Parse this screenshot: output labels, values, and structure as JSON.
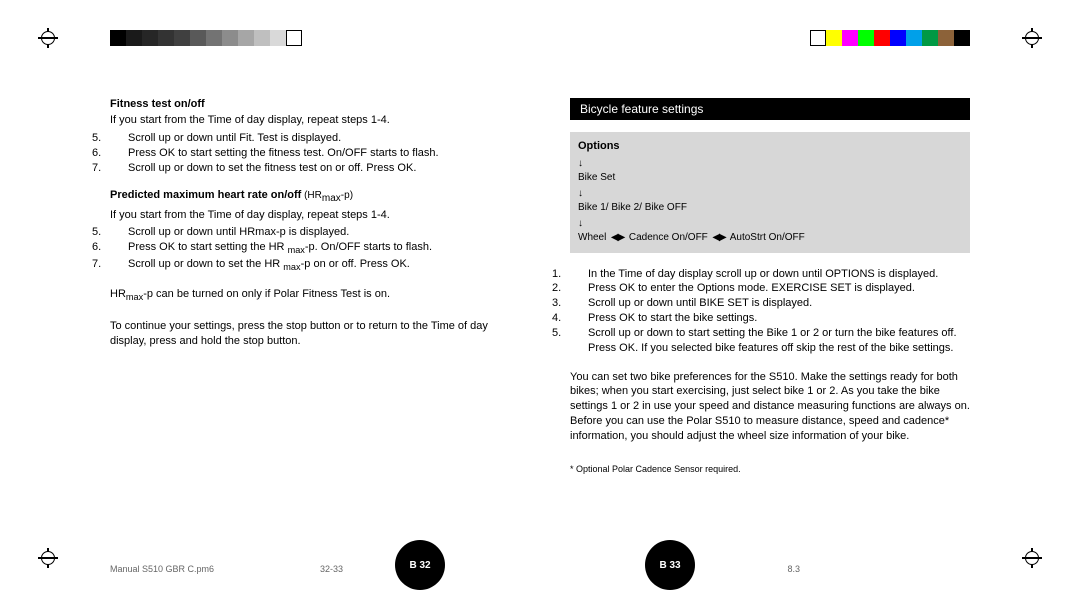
{
  "colorbar_left": [
    "#000000",
    "#1a1a1a",
    "#262626",
    "#333333",
    "#404040",
    "#595959",
    "#737373",
    "#8c8c8c",
    "#a6a6a6",
    "#bfbfbf",
    "#d9d9d9",
    "#ffffff"
  ],
  "colorbar_right": [
    "#ffffff",
    "#ffff00",
    "#ff00ff",
    "#00ff00",
    "#ff0000",
    "#0000ff",
    "#00a0e9",
    "#009944",
    "#8c6239",
    "#000000"
  ],
  "left": {
    "h1": "Fitness test on/off",
    "p1": "If you start from the Time of day display, repeat steps 1-4.",
    "s5": "Scroll up or down until Fit. Test is displayed.",
    "s6": "Press OK to start setting the fitness test. On/OFF starts to flash.",
    "s7": "Scroll up or down to set the fitness test on or off. Press OK.",
    "h2a": "Predicted maximum heart rate on/off",
    "h2b": " (HR",
    "h2c": "max",
    "h2d": "-p)",
    "p2": "If you start from the Time of day display, repeat steps 1-4.",
    "s5b": "Scroll up or down until HRmax-p is displayed.",
    "s6b_a": "Press OK to start setting the HR ",
    "s6b_b": "max",
    "s6b_c": "-p. On/OFF starts to flash.",
    "s7b_a": "Scroll up or down to set the HR ",
    "s7b_b": "max",
    "s7b_c": "-p on or off. Press OK.",
    "note_a": "HR",
    "note_b": "max",
    "note_c": "-p can be turned on only if Polar Fitness Test is on.",
    "tail": "To continue your settings, press the stop button or to return to the Time of day display, press and hold the stop button."
  },
  "right": {
    "band": "Bicycle feature settings",
    "opt_title": "Options",
    "opt_l2": "Bike Set",
    "opt_l3": "Bike 1/ Bike 2/ Bike OFF",
    "opt_l4a": "Wheel",
    "opt_l4b": "Cadence On/OFF",
    "opt_l4c": "AutoStrt On/OFF",
    "s1": "In the Time of day display scroll up or down until OPTIONS is displayed.",
    "s2": "Press OK to enter the Options mode. EXERCISE SET is displayed.",
    "s3": "Scroll up or down until BIKE SET is displayed.",
    "s4": "Press OK to start the bike settings.",
    "s5": "Scroll up or down to start setting the Bike 1 or 2 or turn the bike features off. Press OK. If you selected bike features off skip the rest of the bike settings.",
    "body": "You can set two bike preferences for the S510. Make the settings ready for both bikes; when you start exercising, just select bike 1 or 2. As you take the bike settings 1 or 2 in use your speed and distance measuring functions are always on. Before you can use the Polar S510 to measure distance, speed and cadence* information, you should adjust the wheel size information of your bike.",
    "footnote": "* Optional Polar Cadence Sensor required."
  },
  "pages": {
    "left": "B 32",
    "right": "B 33"
  },
  "meta": {
    "file": "Manual S510 GBR C.pm6",
    "range": "32-33",
    "stamp": "8.3"
  }
}
